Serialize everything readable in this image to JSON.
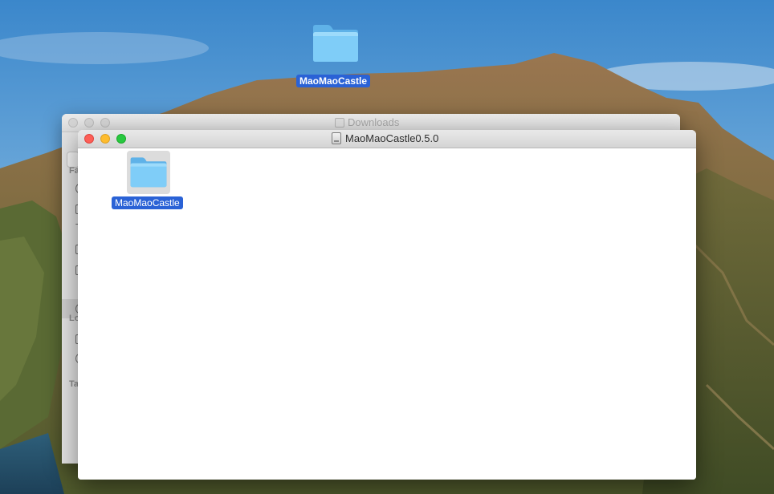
{
  "desktop": {
    "icons": [
      {
        "label": "MaoMaoCastle",
        "icon": "folder-icon",
        "selected": true
      }
    ]
  },
  "windows": {
    "downloads": {
      "title": "Downloads",
      "title_icon": "downloads-icon",
      "active": false,
      "sidebar_partial_headers": [
        "Fa",
        "Lo",
        "Ta"
      ]
    },
    "disk_image": {
      "title": "MaoMaoCastle0.5.0",
      "title_icon": "disk-image-icon",
      "active": true,
      "items": [
        {
          "label": "MaoMaoCastle",
          "icon": "folder-icon",
          "selected": true
        }
      ]
    }
  },
  "colors": {
    "selection": "#2a62d6",
    "close": "#fd5f57",
    "minimize": "#febc2e",
    "zoom": "#28c840",
    "folder": "#6dc3f5"
  }
}
